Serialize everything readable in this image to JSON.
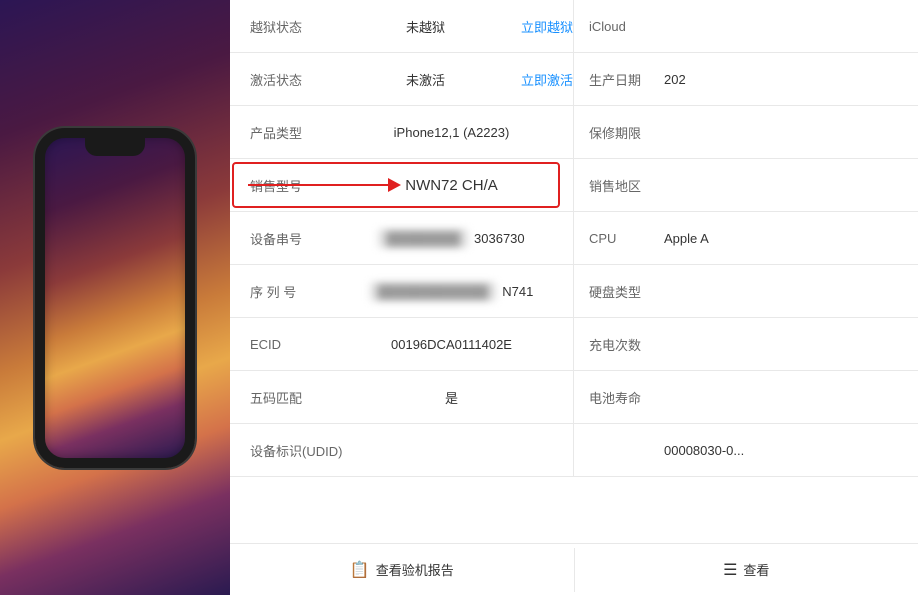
{
  "phone": {
    "panel_bg": "linear-gradient"
  },
  "rows": [
    {
      "left_label": "越狱状态",
      "left_value": "未越狱",
      "left_link": "立即越狱",
      "right_label": "iCloud",
      "right_value": ""
    },
    {
      "left_label": "激活状态",
      "left_value": "未激活",
      "left_link": "立即激活",
      "right_label": "生产日期",
      "right_value": "202"
    },
    {
      "left_label": "产品类型",
      "left_value": "iPhone12,1 (A2223)",
      "left_link": "",
      "right_label": "保修期限",
      "right_value": ""
    },
    {
      "left_label": "销售型号",
      "left_value": "NWN72 CH/A",
      "left_link": "",
      "right_label": "销售地区",
      "right_value": "",
      "highlight": true
    },
    {
      "left_label": "设备串号",
      "left_value_blurred": true,
      "left_value": "3036730",
      "left_link": "",
      "right_label": "CPU",
      "right_value": "Apple A"
    },
    {
      "left_label": "序 列 号",
      "left_value_blurred": true,
      "left_value": "N741",
      "left_link": "",
      "right_label": "硬盘类型",
      "right_value": ""
    },
    {
      "left_label": "ECID",
      "left_value": "00196DCA0111402E",
      "left_link": "",
      "right_label": "充电次数",
      "right_value": ""
    },
    {
      "left_label": "五码匹配",
      "left_value": "是",
      "left_link": "",
      "right_label": "电池寿命",
      "right_value": ""
    },
    {
      "left_label": "设备标识(UDID)",
      "left_value": "",
      "left_link": "",
      "right_label": "",
      "right_value": "00008030-0..."
    }
  ],
  "bottom_buttons": [
    {
      "icon": "📋",
      "label": "查看验机报告"
    },
    {
      "icon": "☰",
      "label": "查看"
    }
  ]
}
